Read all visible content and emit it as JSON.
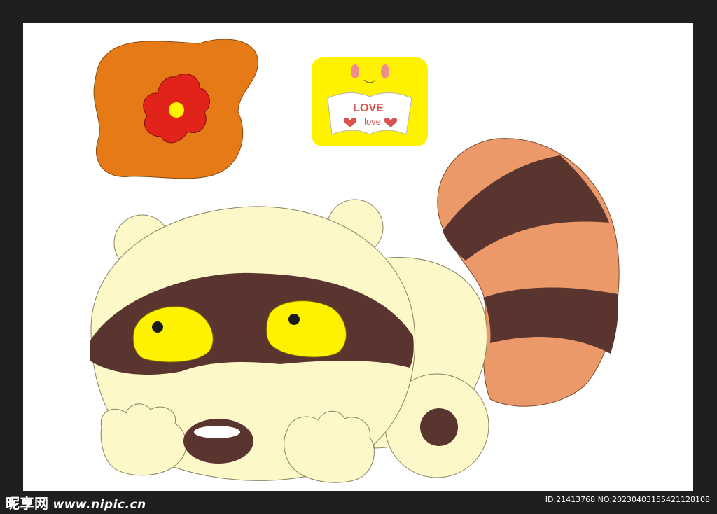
{
  "badge": {
    "title": "LOVE",
    "subtitle": "love"
  },
  "watermark": {
    "brand": "昵享网",
    "site": "www.nipic.cn",
    "id_text": "ID:21413768 NO:20230403155421128108"
  },
  "colors": {
    "background_frame": "#1f1f1f",
    "cream": "#fdf8c8",
    "brown": "#5a3530",
    "tail_orange": "#ec996a",
    "eye_yellow": "#fff200",
    "blob_orange": "#e67a17",
    "flower_red": "#e2231a",
    "badge_yellow": "#fff200",
    "badge_pink": "#d9534f"
  }
}
